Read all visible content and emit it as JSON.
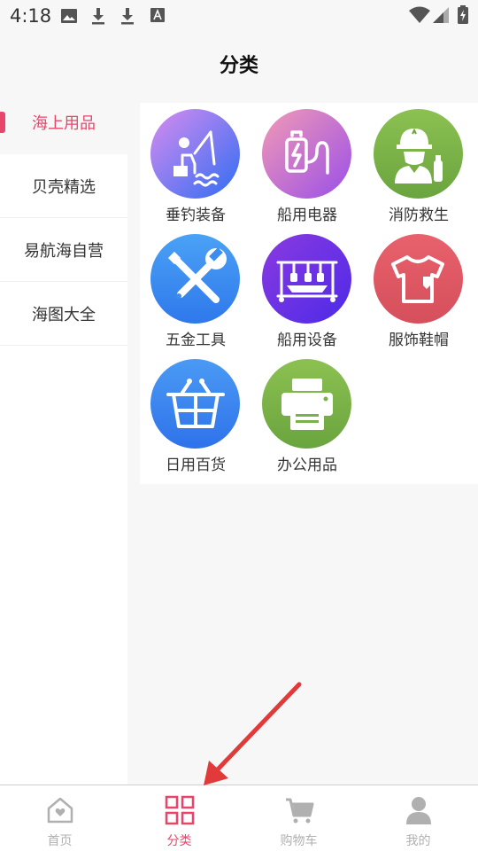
{
  "status_bar": {
    "time": "4:18",
    "left_icons": [
      "image-icon",
      "download-icon",
      "download-icon",
      "font-icon"
    ],
    "right_icons": [
      "wifi-icon",
      "signal-icon",
      "battery-charging-icon"
    ]
  },
  "header": {
    "title": "分类"
  },
  "sidebar": {
    "items": [
      {
        "label": "海上用品",
        "active": true
      },
      {
        "label": "贝壳精选",
        "active": false
      },
      {
        "label": "易航海自营",
        "active": false
      },
      {
        "label": "海图大全",
        "active": false
      }
    ]
  },
  "categories": [
    {
      "label": "垂钓装备",
      "icon": "fishing-icon",
      "color": "#5f7cf5"
    },
    {
      "label": "船用电器",
      "icon": "battery-icon",
      "color": "#c07ad6"
    },
    {
      "label": "消防救生",
      "icon": "firefighter-icon",
      "color": "#7fb24a"
    },
    {
      "label": "五金工具",
      "icon": "tools-icon",
      "color": "#3f8ef2"
    },
    {
      "label": "船用设备",
      "icon": "boat-equipment-icon",
      "color": "#6a2fe0"
    },
    {
      "label": "服饰鞋帽",
      "icon": "shirt-icon",
      "color": "#dd5d68"
    },
    {
      "label": "日用百货",
      "icon": "basket-icon",
      "color": "#3f86f2"
    },
    {
      "label": "办公用品",
      "icon": "printer-icon",
      "color": "#7ab04a"
    }
  ],
  "bottom_nav": {
    "items": [
      {
        "label": "首页",
        "icon": "home-icon",
        "active": false
      },
      {
        "label": "分类",
        "icon": "grid-icon",
        "active": true
      },
      {
        "label": "购物车",
        "icon": "cart-icon",
        "active": false
      },
      {
        "label": "我的",
        "icon": "user-icon",
        "active": false
      }
    ]
  },
  "colors": {
    "accent": "#e8456b",
    "annotation_arrow": "#e03a3a"
  }
}
